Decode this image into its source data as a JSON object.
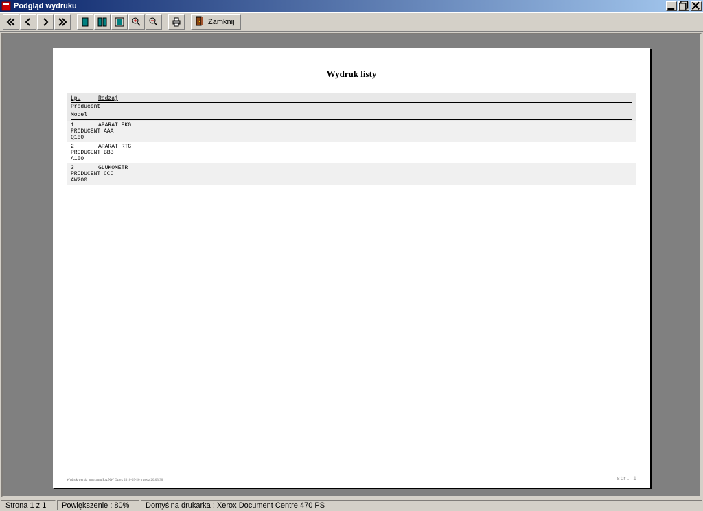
{
  "titlebar": {
    "title": "Podgląd wydruku"
  },
  "toolbar": {
    "close_label": "Zamknij",
    "close_underline": "Z"
  },
  "preview": {
    "title": "Wydruk listy",
    "headers": {
      "lp": "Lp.",
      "rodzaj": "Rodzaj",
      "producent": "Producent",
      "model": "Model"
    },
    "rows": [
      {
        "lp": "1",
        "rodzaj": "APARAT EKG",
        "producent": "PRODUCENT AAA",
        "model": "Q100"
      },
      {
        "lp": "2",
        "rodzaj": "APARAT RTG",
        "producent": "PRODUCENT BBB",
        "model": "A100"
      },
      {
        "lp": "3",
        "rodzaj": "GLUKOMETR",
        "producent": "PRODUCENT CCC",
        "model": "AW200"
      }
    ],
    "footer_left": "Wydruk wersja programu RA.NW Dziex 2010-09-20 o godz 20:03:30",
    "footer_right": "str. 1"
  },
  "statusbar": {
    "page": "Strona 1 z 1",
    "zoom": "Powiększenie : 80%",
    "printer": "Domyślna drukarka : Xerox Document Centre 470 PS"
  }
}
